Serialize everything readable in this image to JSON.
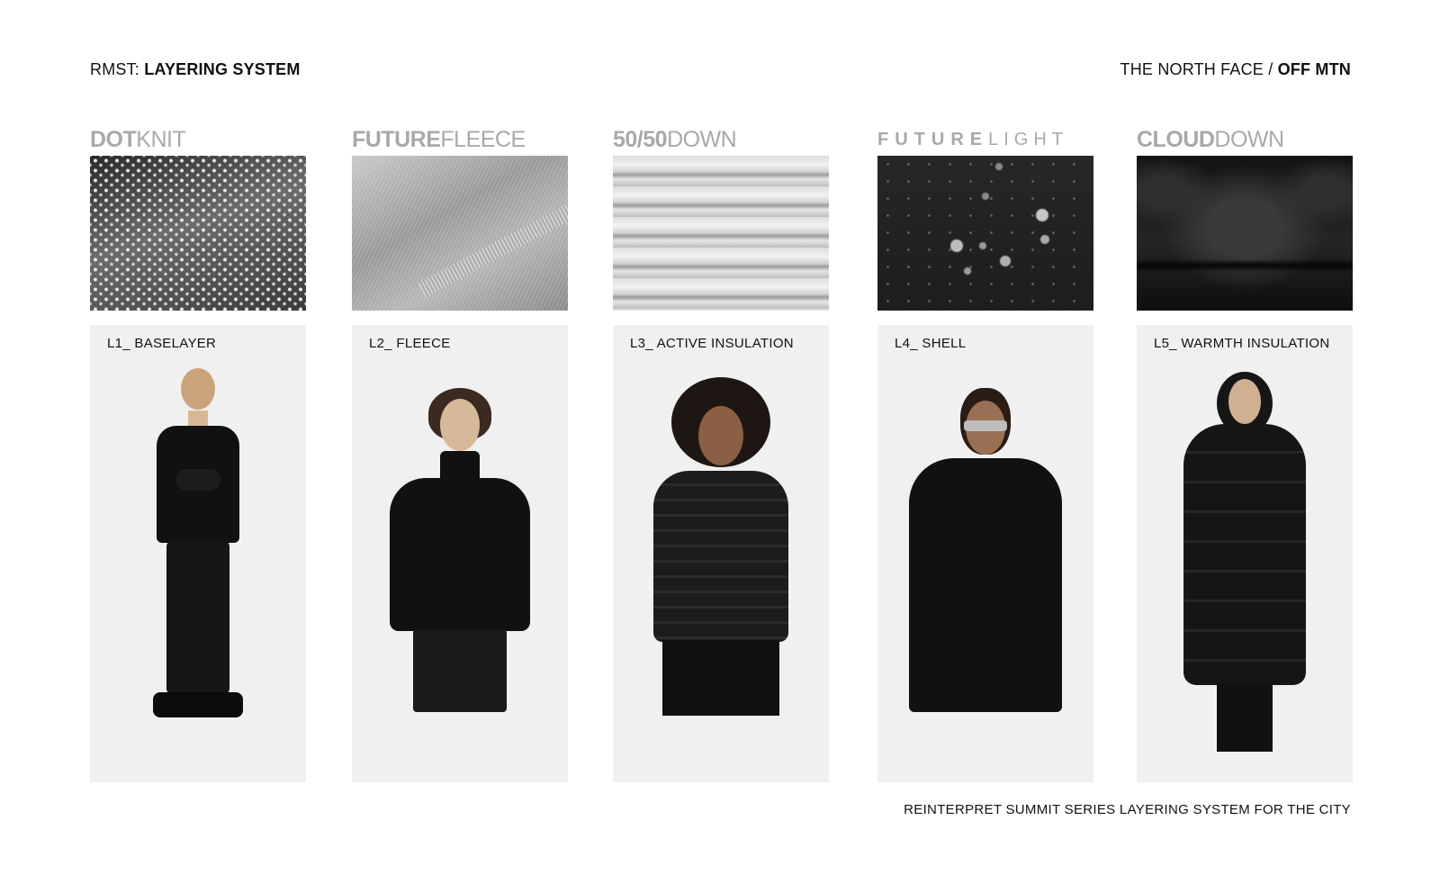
{
  "header": {
    "left_prefix": "RMST: ",
    "left_title": "LAYERING SYSTEM",
    "right_prefix": "THE NORTH FACE / ",
    "right_title": "OFF MTN"
  },
  "columns": [
    {
      "logo_strong": "DOT",
      "logo_light": "KNIT",
      "swatch_icon": "dotknit-fabric-swatch",
      "label": "L1_ BASELAYER"
    },
    {
      "logo_strong": "FUTURE",
      "logo_light": "FLEECE",
      "swatch_icon": "futurefleece-fabric-swatch",
      "label": "L2_ FLEECE"
    },
    {
      "logo_strong": "50/50",
      "logo_light": "DOWN",
      "swatch_icon": "down-quilted-swatch",
      "label": "L3_ ACTIVE INSULATION"
    },
    {
      "logo_strong": "FUTURE",
      "logo_light": "LIGHT",
      "swatch_icon": "futurelight-water-droplet-swatch",
      "label": "L4_ SHELL"
    },
    {
      "logo_strong": "CLOUD",
      "logo_light": "DOWN",
      "swatch_icon": "clouddown-puffer-swatch",
      "label": "L5_ WARMTH INSULATION"
    }
  ],
  "footer": {
    "text": "REINTERPRET SUMMIT SERIES LAYERING SYSTEM FOR THE CITY"
  },
  "colors": {
    "logo_grey": "#a9a9a9",
    "card_bg": "#f0f0f0",
    "garment_black": "#111111"
  }
}
